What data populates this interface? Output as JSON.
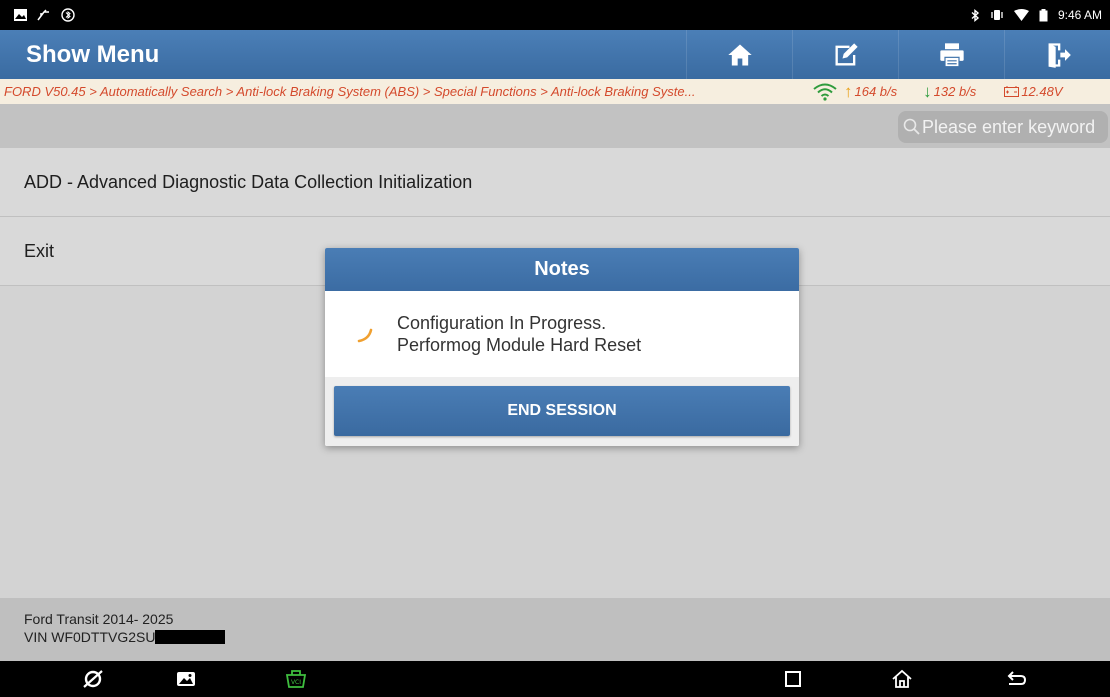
{
  "status_bar": {
    "time": "9:46 AM",
    "left_icons": [
      "image-icon",
      "usb-icon",
      "bluetooth-badge-icon"
    ],
    "right_icons": [
      "bluetooth-icon",
      "vibrate-icon",
      "wifi-icon",
      "battery-icon"
    ]
  },
  "header": {
    "title": "Show Menu",
    "buttons": [
      "home-icon",
      "edit-icon",
      "print-icon",
      "exit-icon"
    ]
  },
  "breadcrumb": {
    "path": "FORD V50.45 > Automatically Search > Anti-lock Braking System (ABS) > Special Functions > Anti-lock Braking Syste...",
    "upload": "164 b/s",
    "download": "132 b/s",
    "voltage": "12.48V"
  },
  "search": {
    "placeholder": "Please enter keyword"
  },
  "menu": {
    "items": [
      {
        "label": "ADD - Advanced Diagnostic Data Collection Initialization"
      },
      {
        "label": "Exit"
      }
    ]
  },
  "footer": {
    "vehicle": "Ford Transit 2014- 2025",
    "vin": "VIN WF0DTTVG2SU"
  },
  "dialog": {
    "title": "Notes",
    "message_line1": "Configuration In Progress.",
    "message_line2": "Performog Module Hard Reset",
    "button": "END SESSION"
  },
  "colors": {
    "header_blue": "#3f72aa",
    "crumb_text": "#d44a2c",
    "upload_arrow": "#e8a21b",
    "download_arrow": "#2e9b3c",
    "vci_green": "#3fbf3f"
  }
}
